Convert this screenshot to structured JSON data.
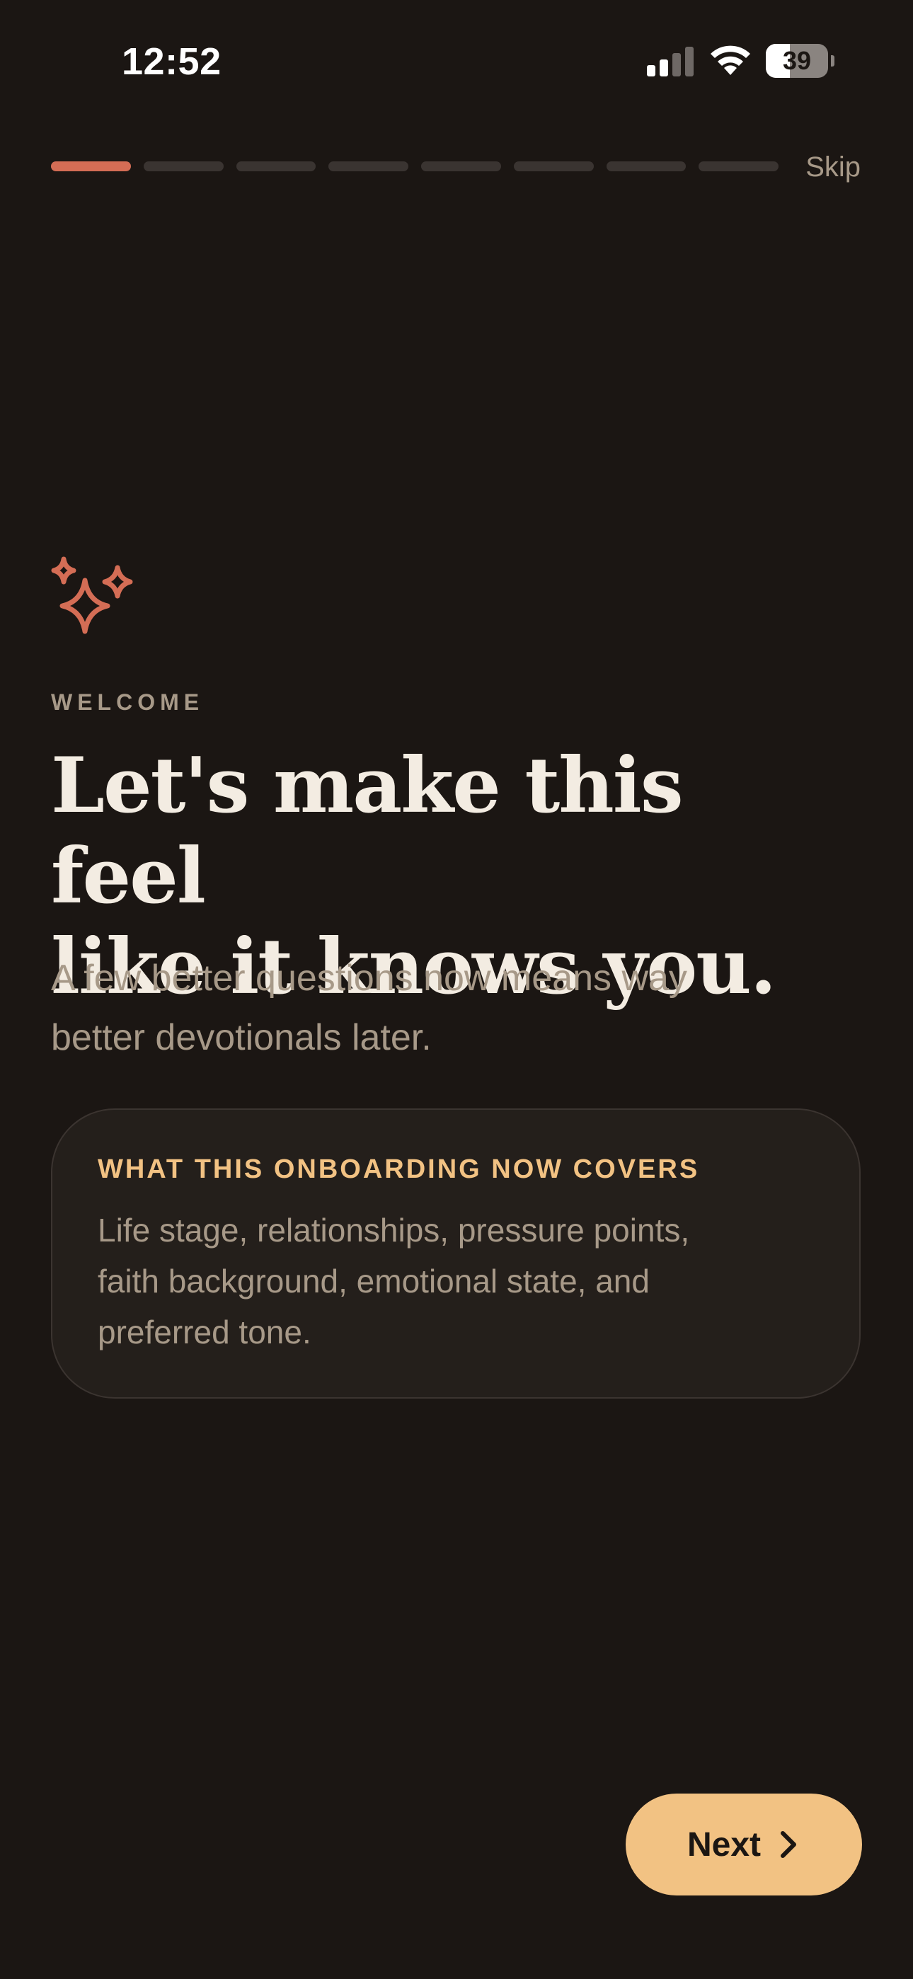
{
  "status_bar": {
    "time": "12:52",
    "battery_level": "39",
    "signal_icon": "cellular-signal-icon",
    "wifi_icon": "wifi-icon",
    "battery_icon": "battery-icon"
  },
  "onboarding": {
    "progress": {
      "total_steps": 8,
      "current_step": 1
    },
    "skip_label": "Skip",
    "icon": "sparkles-icon",
    "eyebrow": "WELCOME",
    "headline_line1": "Let's make this feel",
    "headline_line2": "like it knows you.",
    "subtitle_line1": "A few better questions now means way",
    "subtitle_line2": "better devotionals later.",
    "card": {
      "title": "WHAT THIS ONBOARDING NOW COVERS",
      "body_line1": "Life stage, relationships, pressure points,",
      "body_line2": "faith background, emotional state, and",
      "body_line3": "preferred tone."
    },
    "next_label": "Next",
    "next_icon": "chevron-right-icon"
  },
  "colors": {
    "background": "#1b1613",
    "accent": "#d46d55",
    "button": "#f2c283",
    "muted_text": "#a79988",
    "primary_text": "#f3ece2"
  }
}
